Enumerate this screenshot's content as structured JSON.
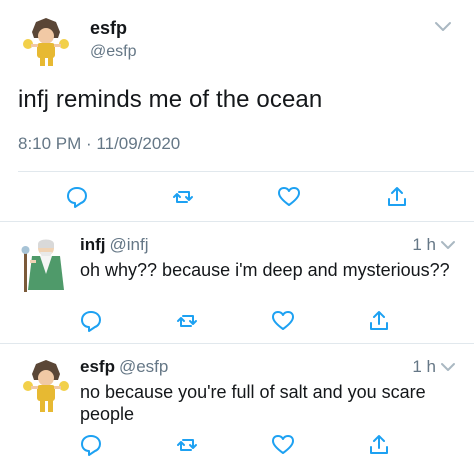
{
  "main_tweet": {
    "display_name": "esfp",
    "handle": "@esfp",
    "text": "infj reminds me of the ocean",
    "timestamp": "8:10 PM · 11/09/2020"
  },
  "replies": [
    {
      "display_name": "infj",
      "handle": "@infj",
      "time": "1 h",
      "text": "oh why?? because i'm deep and mysterious??"
    },
    {
      "display_name": "esfp",
      "handle": "@esfp",
      "time": "1 h",
      "text": "no because you're full of salt and you scare people"
    }
  ],
  "colors": {
    "text": "#14171a",
    "secondary": "#657786",
    "icon": "#1da1f2",
    "divider": "#e1e8ed"
  },
  "icons": [
    "reply-icon",
    "retweet-icon",
    "like-icon",
    "share-icon",
    "chevron-down-icon"
  ]
}
